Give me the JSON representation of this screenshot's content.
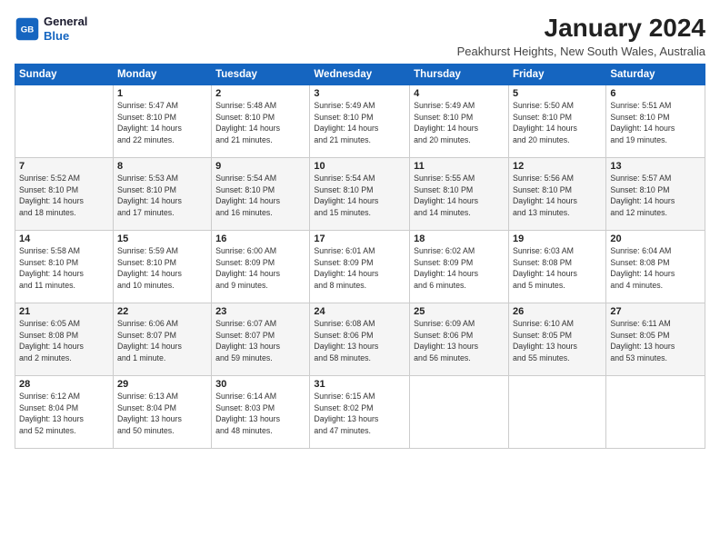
{
  "header": {
    "logo_line1": "General",
    "logo_line2": "Blue",
    "month_title": "January 2024",
    "location": "Peakhurst Heights, New South Wales, Australia"
  },
  "days_of_week": [
    "Sunday",
    "Monday",
    "Tuesday",
    "Wednesday",
    "Thursday",
    "Friday",
    "Saturday"
  ],
  "weeks": [
    [
      {
        "day": "",
        "info": ""
      },
      {
        "day": "1",
        "info": "Sunrise: 5:47 AM\nSunset: 8:10 PM\nDaylight: 14 hours\nand 22 minutes."
      },
      {
        "day": "2",
        "info": "Sunrise: 5:48 AM\nSunset: 8:10 PM\nDaylight: 14 hours\nand 21 minutes."
      },
      {
        "day": "3",
        "info": "Sunrise: 5:49 AM\nSunset: 8:10 PM\nDaylight: 14 hours\nand 21 minutes."
      },
      {
        "day": "4",
        "info": "Sunrise: 5:49 AM\nSunset: 8:10 PM\nDaylight: 14 hours\nand 20 minutes."
      },
      {
        "day": "5",
        "info": "Sunrise: 5:50 AM\nSunset: 8:10 PM\nDaylight: 14 hours\nand 20 minutes."
      },
      {
        "day": "6",
        "info": "Sunrise: 5:51 AM\nSunset: 8:10 PM\nDaylight: 14 hours\nand 19 minutes."
      }
    ],
    [
      {
        "day": "7",
        "info": "Sunrise: 5:52 AM\nSunset: 8:10 PM\nDaylight: 14 hours\nand 18 minutes."
      },
      {
        "day": "8",
        "info": "Sunrise: 5:53 AM\nSunset: 8:10 PM\nDaylight: 14 hours\nand 17 minutes."
      },
      {
        "day": "9",
        "info": "Sunrise: 5:54 AM\nSunset: 8:10 PM\nDaylight: 14 hours\nand 16 minutes."
      },
      {
        "day": "10",
        "info": "Sunrise: 5:54 AM\nSunset: 8:10 PM\nDaylight: 14 hours\nand 15 minutes."
      },
      {
        "day": "11",
        "info": "Sunrise: 5:55 AM\nSunset: 8:10 PM\nDaylight: 14 hours\nand 14 minutes."
      },
      {
        "day": "12",
        "info": "Sunrise: 5:56 AM\nSunset: 8:10 PM\nDaylight: 14 hours\nand 13 minutes."
      },
      {
        "day": "13",
        "info": "Sunrise: 5:57 AM\nSunset: 8:10 PM\nDaylight: 14 hours\nand 12 minutes."
      }
    ],
    [
      {
        "day": "14",
        "info": "Sunrise: 5:58 AM\nSunset: 8:10 PM\nDaylight: 14 hours\nand 11 minutes."
      },
      {
        "day": "15",
        "info": "Sunrise: 5:59 AM\nSunset: 8:10 PM\nDaylight: 14 hours\nand 10 minutes."
      },
      {
        "day": "16",
        "info": "Sunrise: 6:00 AM\nSunset: 8:09 PM\nDaylight: 14 hours\nand 9 minutes."
      },
      {
        "day": "17",
        "info": "Sunrise: 6:01 AM\nSunset: 8:09 PM\nDaylight: 14 hours\nand 8 minutes."
      },
      {
        "day": "18",
        "info": "Sunrise: 6:02 AM\nSunset: 8:09 PM\nDaylight: 14 hours\nand 6 minutes."
      },
      {
        "day": "19",
        "info": "Sunrise: 6:03 AM\nSunset: 8:08 PM\nDaylight: 14 hours\nand 5 minutes."
      },
      {
        "day": "20",
        "info": "Sunrise: 6:04 AM\nSunset: 8:08 PM\nDaylight: 14 hours\nand 4 minutes."
      }
    ],
    [
      {
        "day": "21",
        "info": "Sunrise: 6:05 AM\nSunset: 8:08 PM\nDaylight: 14 hours\nand 2 minutes."
      },
      {
        "day": "22",
        "info": "Sunrise: 6:06 AM\nSunset: 8:07 PM\nDaylight: 14 hours\nand 1 minute."
      },
      {
        "day": "23",
        "info": "Sunrise: 6:07 AM\nSunset: 8:07 PM\nDaylight: 13 hours\nand 59 minutes."
      },
      {
        "day": "24",
        "info": "Sunrise: 6:08 AM\nSunset: 8:06 PM\nDaylight: 13 hours\nand 58 minutes."
      },
      {
        "day": "25",
        "info": "Sunrise: 6:09 AM\nSunset: 8:06 PM\nDaylight: 13 hours\nand 56 minutes."
      },
      {
        "day": "26",
        "info": "Sunrise: 6:10 AM\nSunset: 8:05 PM\nDaylight: 13 hours\nand 55 minutes."
      },
      {
        "day": "27",
        "info": "Sunrise: 6:11 AM\nSunset: 8:05 PM\nDaylight: 13 hours\nand 53 minutes."
      }
    ],
    [
      {
        "day": "28",
        "info": "Sunrise: 6:12 AM\nSunset: 8:04 PM\nDaylight: 13 hours\nand 52 minutes."
      },
      {
        "day": "29",
        "info": "Sunrise: 6:13 AM\nSunset: 8:04 PM\nDaylight: 13 hours\nand 50 minutes."
      },
      {
        "day": "30",
        "info": "Sunrise: 6:14 AM\nSunset: 8:03 PM\nDaylight: 13 hours\nand 48 minutes."
      },
      {
        "day": "31",
        "info": "Sunrise: 6:15 AM\nSunset: 8:02 PM\nDaylight: 13 hours\nand 47 minutes."
      },
      {
        "day": "",
        "info": ""
      },
      {
        "day": "",
        "info": ""
      },
      {
        "day": "",
        "info": ""
      }
    ]
  ]
}
